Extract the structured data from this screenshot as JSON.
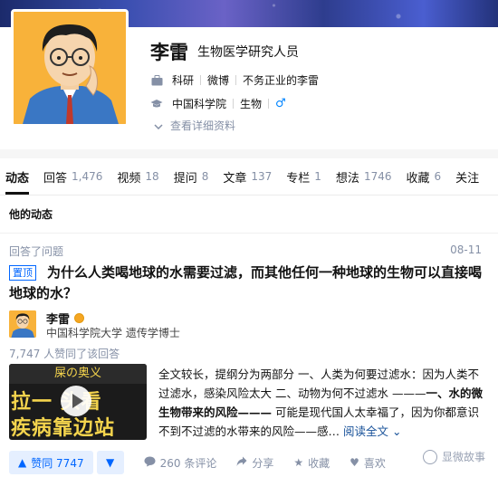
{
  "profile": {
    "name": "李雷",
    "headline": "生物医学研究人员",
    "industry": "科研",
    "weibo": "微博",
    "weibo_name": "不务正业的李雷",
    "school": "中国科学院",
    "major": "生物",
    "gender_symbol": "♂",
    "more_label": "查看详细资料"
  },
  "tabs": [
    {
      "label": "动态",
      "count": ""
    },
    {
      "label": "回答",
      "count": "1,476"
    },
    {
      "label": "视频",
      "count": "18"
    },
    {
      "label": "提问",
      "count": "8"
    },
    {
      "label": "文章",
      "count": "137"
    },
    {
      "label": "专栏",
      "count": "1"
    },
    {
      "label": "想法",
      "count": "1746"
    },
    {
      "label": "收藏",
      "count": "6"
    },
    {
      "label": "关注",
      "count": ""
    }
  ],
  "feed": {
    "section_title": "他的动态",
    "item": {
      "action": "回答了问题",
      "date": "08-11",
      "pinned_label": "置顶",
      "question": "为什么人类喝地球的水需要过滤，而其他任何一种地球的生物可以直接喝地球的水？",
      "author_name": "李雷",
      "author_bio": "中国科学院大学 遗传学博士",
      "voters": "7,747 人赞同了该回答",
      "thumbnail": {
        "line1": "屎の奥义",
        "line2": "拉一  头看",
        "line3": "疾病靠边站"
      },
      "excerpt_before": "全文较长，提纲分为两部分 一、人类为何要过滤水：因为人类不过滤水，感染风险太大 二、动物为何不过滤水 ———",
      "excerpt_bold": "一、水的微生物带来的风险———",
      "excerpt_after": " 可能是现代国人太幸福了，因为你都意识不到不过滤的水带来的风险——感…",
      "read_all": "阅读全文",
      "actions": {
        "upvote": "赞同 7747",
        "comments": "260 条评论",
        "share": "分享",
        "favorite": "收藏",
        "like": "喜欢"
      }
    }
  },
  "watermark": "显微故事",
  "colors": {
    "accent": "#0066ff",
    "avatar_bg": "#f8b23a",
    "muted": "#8590a6"
  }
}
